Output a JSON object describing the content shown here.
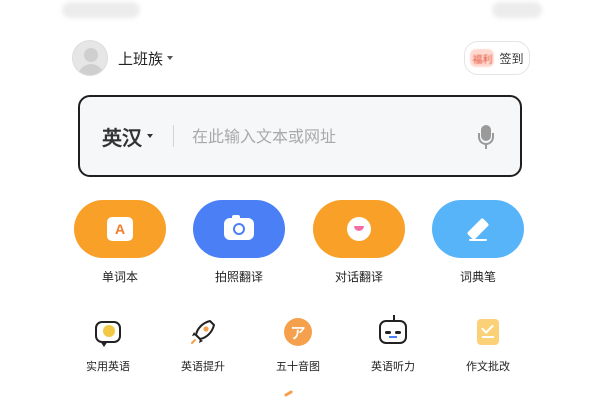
{
  "header": {
    "username": "上班族",
    "checkin": {
      "badge": "福利",
      "label": "签到"
    }
  },
  "search": {
    "language": "英汉",
    "placeholder": "在此输入文本或网址"
  },
  "features": [
    {
      "label": "单词本",
      "icon": "wordbook-icon",
      "color": "#f9a028"
    },
    {
      "label": "拍照翻译",
      "icon": "camera-icon",
      "color": "#4b7ff6"
    },
    {
      "label": "对话翻译",
      "icon": "smile-icon",
      "color": "#f9a028"
    },
    {
      "label": "词典笔",
      "icon": "pen-icon",
      "color": "#58b4f9"
    }
  ],
  "tools": [
    {
      "label": "实用英语",
      "icon": "chat-bubble-icon"
    },
    {
      "label": "英语提升",
      "icon": "rocket-icon"
    },
    {
      "label": "五十音图",
      "icon": "kana-icon",
      "glyph": "ア"
    },
    {
      "label": "英语听力",
      "icon": "robot-icon"
    },
    {
      "label": "作文批改",
      "icon": "essay-check-icon"
    }
  ]
}
